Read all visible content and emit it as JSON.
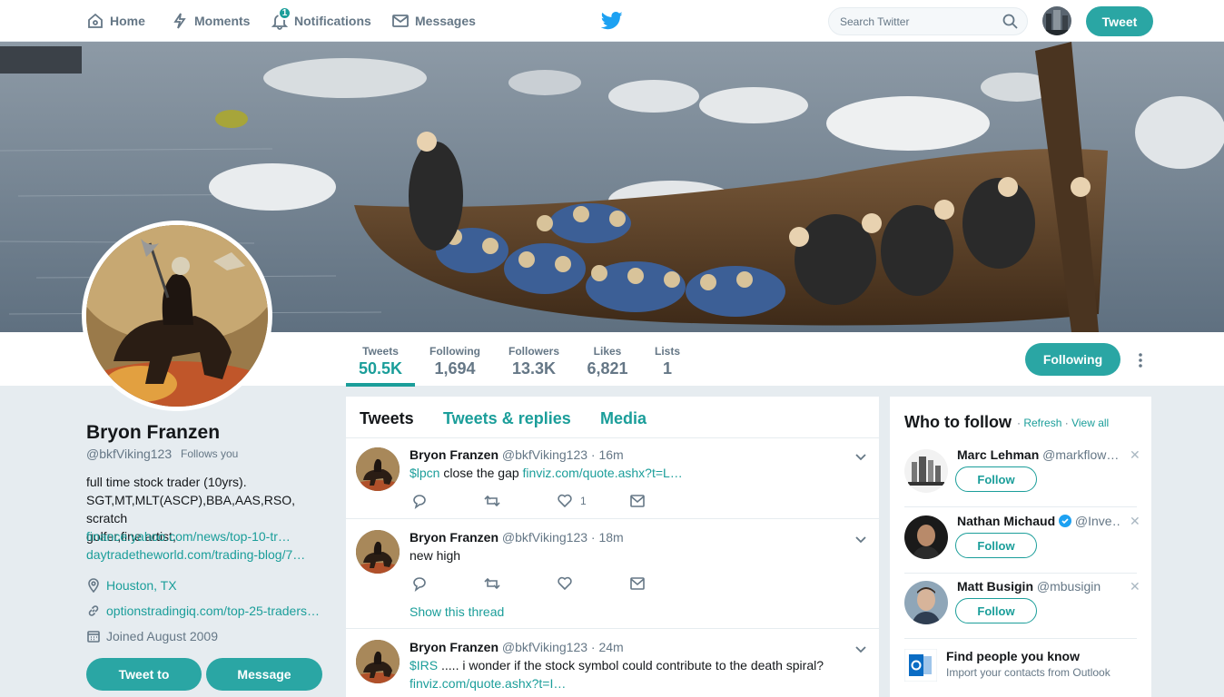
{
  "nav": {
    "home": "Home",
    "moments": "Moments",
    "notifications": "Notifications",
    "notifications_count": "1",
    "messages": "Messages",
    "search_placeholder": "Search Twitter",
    "tweet_button": "Tweet"
  },
  "stats": {
    "tweets_label": "Tweets",
    "tweets_value": "50.5K",
    "following_label": "Following",
    "following_value": "1,694",
    "followers_label": "Followers",
    "followers_value": "13.3K",
    "likes_label": "Likes",
    "likes_value": "6,821",
    "lists_label": "Lists",
    "lists_value": "1",
    "following_button": "Following"
  },
  "profile": {
    "name": "Bryon Franzen",
    "handle": "@bkfViking123",
    "follows_you": "Follows you",
    "bio_line1": "full time stock trader (10yrs).",
    "bio_line2": "SGT,MT,MLT(ASCP),BBA,AAS,RSO, scratch",
    "bio_line3": "golfer,fine artist,",
    "bio_link1": "finance.yahoo.com/news/top-10-tr…",
    "bio_link2": "daytradetheworld.com/trading-blog/7…",
    "location": "Houston, TX",
    "website": "optionstradingiq.com/top-25-traders…",
    "joined": "Joined August 2009",
    "tweet_to": "Tweet to",
    "message": "Message"
  },
  "tabs": {
    "tweets": "Tweets",
    "replies": "Tweets & replies",
    "media": "Media"
  },
  "tweets": [
    {
      "name": "Bryon Franzen",
      "handle_time": "@bkfViking123 · 16m",
      "ticker": "$lpcn",
      "text": " close the gap ",
      "link": "finviz.com/quote.ashx?t=L…",
      "likes": "1"
    },
    {
      "name": "Bryon Franzen",
      "handle_time": "@bkfViking123 · 18m",
      "text": "new high",
      "show_thread": "Show this thread"
    },
    {
      "name": "Bryon Franzen",
      "handle_time": "@bkfViking123 · 24m",
      "ticker": "$IRS",
      "text": " ..... i wonder if the stock symbol could contribute to the death spiral?",
      "link": "finviz.com/quote.ashx?t=I…"
    }
  ],
  "who_to_follow": {
    "title": "Who to follow",
    "dot": "·",
    "refresh": "Refresh",
    "view_all": "View all",
    "follow_label": "Follow",
    "users": [
      {
        "name": "Marc Lehman",
        "handle": "@markflow…"
      },
      {
        "name": "Nathan Michaud",
        "handle": "@Inve…"
      },
      {
        "name": "Matt Busigin",
        "handle": "@mbusigin"
      }
    ],
    "find_title": "Find people you know",
    "find_sub": "Import your contacts from Outlook"
  },
  "colors": {
    "accent": "#1b9e9a",
    "button": "#2aa6a4",
    "twitter_blue": "#1da1f2"
  }
}
